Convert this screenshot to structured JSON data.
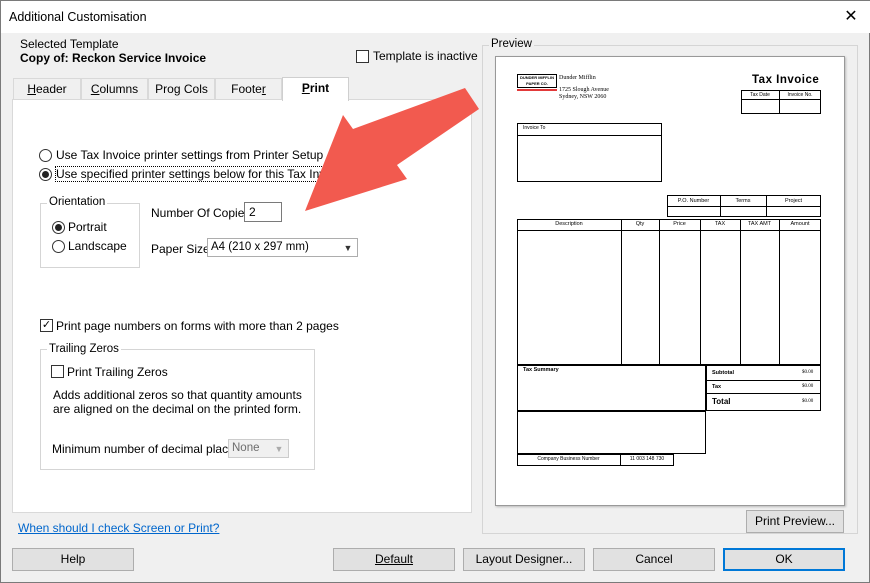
{
  "window": {
    "title": "Additional Customisation",
    "close_glyph": "✕"
  },
  "selected_template": {
    "label": "Selected Template",
    "name": "Copy of: Reckon Service Invoice",
    "inactive_label": "Template is inactive",
    "inactive_checked": false
  },
  "tabs": [
    {
      "label": "Header",
      "underline": "H",
      "rest": "eader"
    },
    {
      "label": "Columns",
      "underline": "C",
      "rest": "olumns"
    },
    {
      "label": "Prog Cols",
      "pre": "Pro",
      "underline": "g",
      "rest": " Cols"
    },
    {
      "label": "Footer",
      "pre": "Foote",
      "underline": "r",
      "rest": ""
    },
    {
      "label": "Print",
      "pre": "",
      "underline": "P",
      "rest": "rint"
    }
  ],
  "print_tab": {
    "option_printer_setup": "Use Tax Invoice printer settings from Printer Setup",
    "option_specified": "Use specified printer settings below for this Tax Invoice",
    "selected_option": "specified",
    "orientation": {
      "label": "Orientation",
      "portrait": "Portrait",
      "landscape": "Landscape",
      "selected": "portrait"
    },
    "copies_label": "Number Of Copies",
    "copies_value": "2",
    "paper_size_label": "Paper Size",
    "paper_size_value": "A4 (210 x 297 mm)",
    "page_numbers_label": "Print page numbers on forms with more than 2 pages",
    "page_numbers_checked": true,
    "trailing_zeros": {
      "label": "Trailing Zeros",
      "print_label": "Print Trailing Zeros",
      "print_checked": false,
      "description": "Adds additional zeros so that quantity amounts are aligned on the decimal on the printed form.",
      "decimal_label": "Minimum number of decimal places:",
      "decimal_value": "None"
    }
  },
  "help_link": "When should I check Screen or Print?",
  "preview": {
    "label": "Preview",
    "logo_text": "DUNDER MIFFLIN PAPER CO.",
    "company_lines": [
      "Dunder Mifflin",
      "1725 Slough Avenue",
      "Sydney, NSW 2060"
    ],
    "title": "Tax Invoice",
    "tax_date": "Tax Date",
    "invoice_no": "Invoice No.",
    "invoice_to": "Invoice To",
    "po_number": "P.O. Number",
    "terms": "Terms",
    "project": "Project",
    "columns": [
      "Description",
      "Qty",
      "Price",
      "TAX",
      "TAX AMT",
      "Amount"
    ],
    "tax_summary": "Tax Summary",
    "subtotal": "Subtotal",
    "tax": "Tax",
    "total": "Total",
    "subtotal_value": "$0.00",
    "tax_value": "$0.00",
    "total_value": "$0.00",
    "abn_label": "Company Business Number",
    "abn_value": "11 003 148 730",
    "print_preview_button": "Print Preview..."
  },
  "buttons": {
    "help": "Help",
    "default": "Default",
    "layout_designer": "Layout Designer...",
    "cancel": "Cancel",
    "ok": "OK"
  },
  "colors": {
    "accent": "#0078d7",
    "arrow": "#f25a4f",
    "link": "#0066cc"
  }
}
